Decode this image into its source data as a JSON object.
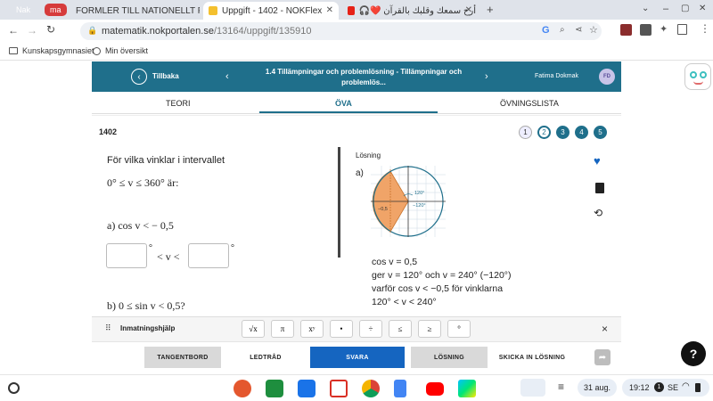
{
  "browser": {
    "tab_groups": [
      {
        "label": "Nak",
        "color": "#c65dd6"
      },
      {
        "label": "ma",
        "color": "#d63b3b"
      }
    ],
    "tabs": [
      {
        "title": "FORMLER TILL NATIONELLT PRO",
        "icon": "pdf-icon"
      },
      {
        "title": "Uppgift - 1402 - NOKFlex",
        "icon": "nok-icon",
        "active": true
      },
      {
        "title": "🎧❤️ أرح سمعك وقلبك بالقرآن",
        "icon": "youtube-icon"
      }
    ],
    "url_domain": "matematik.nokportalen.se",
    "url_path": "/13164/uppgift/135910",
    "bookmarks": [
      "Kunskapsgymnasiet",
      "Min översikt"
    ]
  },
  "header": {
    "back_label": "Tillbaka",
    "chapter_title": "1.4 Tillämpningar och problemlösning - Tillämpningar och problemlös...",
    "user_name": "Fatima Dokmak",
    "avatar_initials": "FD"
  },
  "subtabs": {
    "teori": "TEORI",
    "ova": "ÖVA",
    "ovningslista": "ÖVNINGSLISTA"
  },
  "task": {
    "number": "1402",
    "badges": [
      "1",
      "2",
      "3",
      "4",
      "5"
    ],
    "question_intro": "För vilka vinklar i intervallet",
    "interval": "0° ≤ v ≤ 360° är:",
    "part_a": "a) cos v < − 0,5",
    "degree": "°",
    "lt_v_lt": "< v <",
    "part_b": "b) 0 ≤ sin v < 0,5?"
  },
  "solution": {
    "heading": "Lösning",
    "part_label": "a)",
    "circle_labels": {
      "top": "120°",
      "bottom": "−120°",
      "left": "−0,5"
    },
    "lines": [
      "cos v = 0,5",
      "ger  v = 120°  och  v = 240° (−120°)",
      "varför  cos v < −0,5  för vinklarna",
      "120° < v < 240°"
    ]
  },
  "input_help": {
    "label": "Inmatningshjälp",
    "keys": [
      "√x",
      "π",
      "xʸ",
      "•",
      "÷",
      "≤",
      "≥",
      "°"
    ],
    "close": "×"
  },
  "actions": {
    "tangentbord": "TANGENTBORD",
    "ledtrad": "LEDTRÅD",
    "svara": "SVARA",
    "losning": "LÖSNING",
    "skicka": "SKICKA IN LÖSNING"
  },
  "shelf": {
    "date": "31 aug.",
    "time": "19:12",
    "notification_count": "1",
    "locale": "SE"
  },
  "colors": {
    "brand": "#1f6f8b",
    "svara": "#1565c0",
    "shade": "#f0a468"
  }
}
